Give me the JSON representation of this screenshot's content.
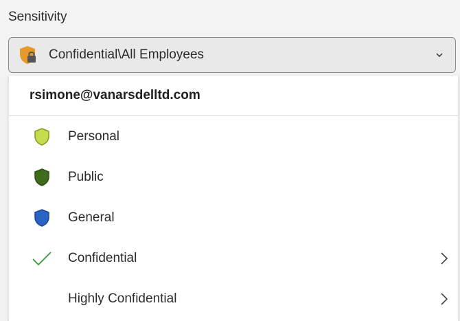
{
  "sensitivity": {
    "label": "Sensitivity",
    "selected": "Confidential\\All Employees",
    "selected_icon": "shield-lock-icon"
  },
  "menu": {
    "account": "rsimone@vanarsdelltd.com",
    "items": [
      {
        "label": "Personal",
        "icon": "shield-icon",
        "color": "#a7c63a",
        "has_submenu": false
      },
      {
        "label": "Public",
        "icon": "shield-icon",
        "color": "#3e6b1d",
        "has_submenu": false
      },
      {
        "label": "General",
        "icon": "shield-icon",
        "color": "#2a63c4",
        "has_submenu": false
      },
      {
        "label": "Confidential",
        "icon": "check-icon",
        "color": "#3a9a3a",
        "has_submenu": true
      },
      {
        "label": "Highly Confidential",
        "icon": "",
        "color": "",
        "has_submenu": true
      }
    ]
  },
  "colors": {
    "selected_shield": "#e59a2a",
    "lock": "#555555"
  }
}
